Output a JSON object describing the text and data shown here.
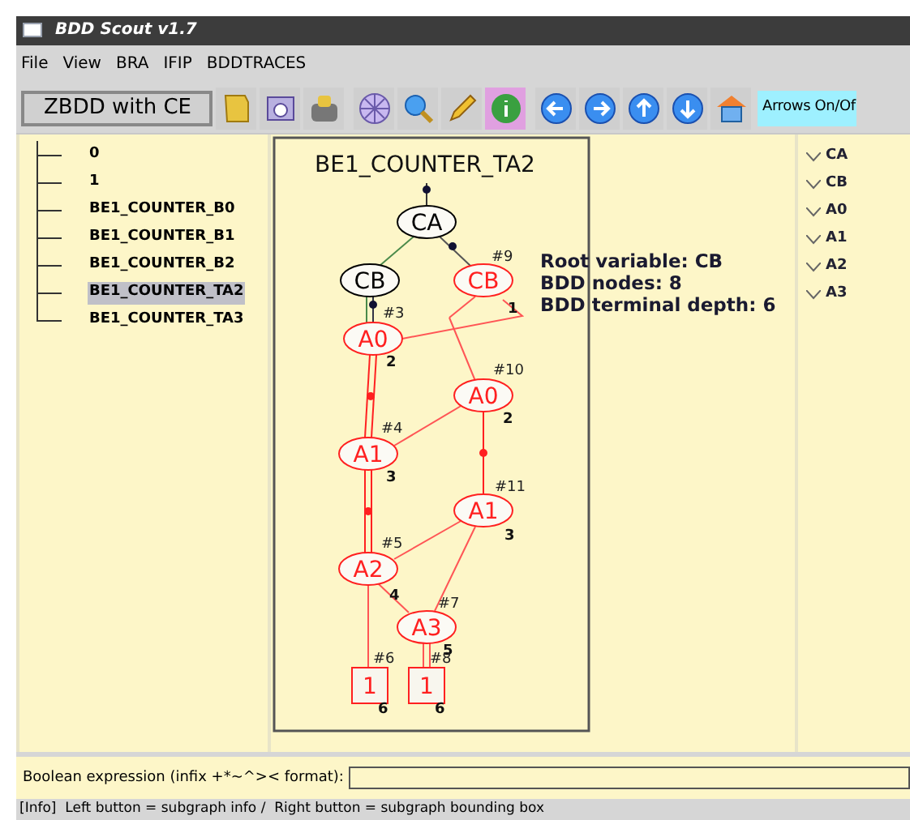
{
  "window": {
    "title": "BDD Scout v1.7"
  },
  "menu": [
    "File",
    "View",
    "BRA",
    "IFIP",
    "BDDTRACES"
  ],
  "toolbar": {
    "mode_select": "ZBDD with CE",
    "tools": [
      {
        "selected": false
      },
      {
        "selected": false
      },
      {
        "selected": false
      },
      {
        "selected": false
      },
      {
        "selected": false
      },
      {
        "selected": false
      },
      {
        "selected": true
      },
      {
        "selected": false
      },
      {
        "selected": false
      },
      {
        "selected": false
      },
      {
        "selected": false
      },
      {
        "selected": false
      }
    ],
    "arrows_button": "Arrows On/Of"
  },
  "tree": [
    {
      "label": "0",
      "selected": false
    },
    {
      "label": "1",
      "selected": false
    },
    {
      "label": "BE1_COUNTER_B0",
      "selected": false
    },
    {
      "label": "BE1_COUNTER_B1",
      "selected": false
    },
    {
      "label": "BE1_COUNTER_B2",
      "selected": false
    },
    {
      "label": "BE1_COUNTER_TA2",
      "selected": true
    },
    {
      "label": "BE1_COUNTER_TA3",
      "selected": false
    }
  ],
  "graph": {
    "title": "BE1_COUNTER_TA2",
    "nodes": [
      {
        "kind": "ellipse",
        "label": "CA",
        "color": "#000000"
      },
      {
        "kind": "ellipse",
        "label": "CB",
        "color": "#000000"
      },
      {
        "kind": "ellipse",
        "label": "CB",
        "number": "#9",
        "depth": "1",
        "color": "#ff2020"
      },
      {
        "kind": "ellipse",
        "label": "A0",
        "number": "#3",
        "depth": "2",
        "color": "#ff2020"
      },
      {
        "kind": "ellipse",
        "label": "A0",
        "number": "#10",
        "depth": "2",
        "color": "#ff2020"
      },
      {
        "kind": "ellipse",
        "label": "A1",
        "number": "#4",
        "depth": "3",
        "color": "#ff2020"
      },
      {
        "kind": "ellipse",
        "label": "A1",
        "number": "#11",
        "depth": "3",
        "color": "#ff2020"
      },
      {
        "kind": "ellipse",
        "label": "A2",
        "number": "#5",
        "depth": "4",
        "color": "#ff2020"
      },
      {
        "kind": "ellipse",
        "label": "A3",
        "number": "#7",
        "depth": "5",
        "color": "#ff2020"
      },
      {
        "kind": "terminal",
        "label": "1",
        "number": "#6",
        "depth": "6",
        "color": "#ff2020"
      },
      {
        "kind": "terminal",
        "label": "1",
        "number": "#8",
        "depth": "6",
        "color": "#ff2020"
      }
    ],
    "info": [
      "Root variable: CB",
      "BDD nodes: 8",
      "BDD terminal depth: 6"
    ]
  },
  "variables": [
    "CA",
    "CB",
    "A0",
    "A1",
    "A2",
    "A3"
  ],
  "expression": {
    "label": "Boolean expression (infix +*~^>< format):"
  },
  "status_bar": "[Info]  Left button = subgraph info /  Right button = subgraph bounding box"
}
